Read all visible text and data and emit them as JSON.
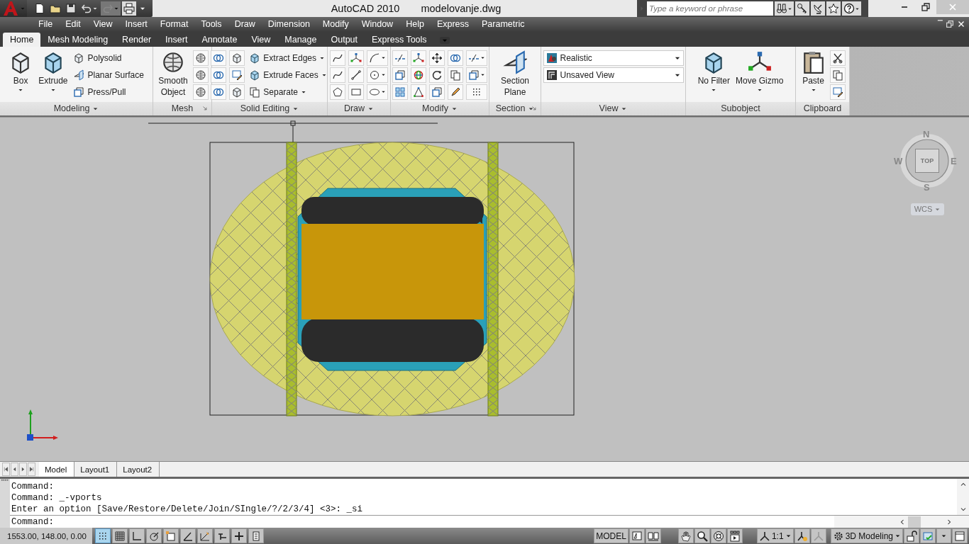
{
  "title": {
    "app": "AutoCAD 2010",
    "file": "modelovanje.dwg"
  },
  "search": {
    "placeholder": "Type a keyword or phrase"
  },
  "menu": [
    "File",
    "Edit",
    "View",
    "Insert",
    "Format",
    "Tools",
    "Draw",
    "Dimension",
    "Modify",
    "Window",
    "Help",
    "Express",
    "Parametric"
  ],
  "ribbon_tabs": [
    {
      "label": "Home",
      "selected": true
    },
    {
      "label": "Mesh Modeling",
      "selected": false
    },
    {
      "label": "Render",
      "selected": false
    },
    {
      "label": "Insert",
      "selected": false
    },
    {
      "label": "Annotate",
      "selected": false
    },
    {
      "label": "View",
      "selected": false
    },
    {
      "label": "Manage",
      "selected": false
    },
    {
      "label": "Output",
      "selected": false
    },
    {
      "label": "Express Tools",
      "selected": false
    }
  ],
  "ribbon_panels": [
    {
      "title": "Modeling",
      "menu": true,
      "launcher": false,
      "columns": [
        [
          {
            "kind": "large",
            "label": "Box",
            "menu": true
          }
        ],
        [
          {
            "kind": "large",
            "label": "Extrude",
            "menu": true
          }
        ],
        [
          {
            "kind": "small",
            "label": "Polysolid",
            "menu": false
          },
          {
            "kind": "small",
            "label": "Planar Surface",
            "menu": false
          },
          {
            "kind": "small",
            "label": "Press/Pull",
            "menu": false
          }
        ]
      ]
    },
    {
      "title": "Mesh",
      "menu": false,
      "launcher": true,
      "columns": [
        [
          {
            "kind": "large",
            "label": "Smooth Object",
            "menu": false
          }
        ],
        [
          {
            "kind": "icon",
            "menu": false
          },
          {
            "kind": "icon",
            "menu": false
          },
          {
            "kind": "icon",
            "menu": false
          }
        ]
      ]
    },
    {
      "title": "Solid Editing",
      "menu": true,
      "launcher": false,
      "columns": [
        [
          {
            "kind": "icon",
            "menu": false
          },
          {
            "kind": "icon",
            "menu": false
          },
          {
            "kind": "icon",
            "menu": false
          }
        ],
        [
          {
            "kind": "icon",
            "menu": false
          },
          {
            "kind": "icon",
            "menu": false
          },
          {
            "kind": "icon",
            "menu": false
          }
        ],
        [
          {
            "kind": "small",
            "label": "Extract Edges",
            "menu": true
          },
          {
            "kind": "small",
            "label": "Extrude Faces",
            "menu": true
          },
          {
            "kind": "small",
            "label": "Separate",
            "menu": true
          }
        ]
      ]
    },
    {
      "title": "Draw",
      "menu": true,
      "launcher": false,
      "columns": [
        [
          {
            "kind": "icon",
            "menu": false
          },
          {
            "kind": "icon",
            "menu": false
          },
          {
            "kind": "icon",
            "menu": false
          }
        ],
        [
          {
            "kind": "icon",
            "menu": false
          },
          {
            "kind": "icon",
            "menu": false
          },
          {
            "kind": "icon",
            "menu": false
          }
        ],
        [
          {
            "kind": "icon",
            "menu": true
          },
          {
            "kind": "icon",
            "menu": true
          },
          {
            "kind": "icon",
            "menu": true
          }
        ]
      ]
    },
    {
      "title": "Modify",
      "menu": true,
      "launcher": false,
      "columns": [
        [
          {
            "kind": "icon",
            "menu": false
          },
          {
            "kind": "icon",
            "menu": false
          },
          {
            "kind": "icon",
            "menu": false
          }
        ],
        [
          {
            "kind": "icon",
            "menu": false
          },
          {
            "kind": "icon",
            "menu": false
          },
          {
            "kind": "icon",
            "menu": false
          }
        ],
        [
          {
            "kind": "icon",
            "menu": false
          },
          {
            "kind": "icon",
            "menu": false
          },
          {
            "kind": "icon",
            "menu": false
          }
        ],
        [
          {
            "kind": "icon",
            "menu": false
          },
          {
            "kind": "icon",
            "menu": false
          },
          {
            "kind": "icon",
            "menu": false
          }
        ],
        [
          {
            "kind": "icon",
            "menu": true
          },
          {
            "kind": "icon",
            "menu": true
          },
          {
            "kind": "icon",
            "menu": false
          }
        ]
      ]
    },
    {
      "title": "Section",
      "menu": true,
      "launcher": true,
      "columns": [
        [
          {
            "kind": "large",
            "label": "Section Plane",
            "menu": false
          }
        ]
      ]
    },
    {
      "title": "View",
      "menu": true,
      "launcher": false,
      "columns": [
        [
          {
            "kind": "dropdown",
            "label": "Realistic"
          },
          {
            "kind": "dropdown",
            "label": "Unsaved View"
          }
        ]
      ]
    },
    {
      "title": "Subobject",
      "menu": false,
      "launcher": false,
      "columns": [
        [
          {
            "kind": "large",
            "label": "No Filter",
            "menu": true
          }
        ],
        [
          {
            "kind": "large",
            "label": "Move Gizmo",
            "menu": true
          }
        ]
      ]
    },
    {
      "title": "Clipboard",
      "menu": false,
      "launcher": false,
      "columns": [
        [
          {
            "kind": "large",
            "label": "Paste",
            "menu": true
          }
        ],
        [
          {
            "kind": "icon",
            "menu": false
          },
          {
            "kind": "icon",
            "menu": false
          },
          {
            "kind": "icon",
            "menu": false
          }
        ]
      ]
    }
  ],
  "viewcube": {
    "face": "TOP",
    "north": "N",
    "south": "S",
    "east": "E",
    "west": "W",
    "coordinate_system": "WCS"
  },
  "layout_tabs": [
    {
      "label": "Model",
      "selected": true
    },
    {
      "label": "Layout1",
      "selected": false
    },
    {
      "label": "Layout2",
      "selected": false
    }
  ],
  "command_history": [
    "Command:",
    "Command: _-vports",
    "Enter an option [Save/Restore/Delete/Join/SIngle/?/2/3/4] <3>: _si"
  ],
  "command_prompt": "Command:",
  "status_bar": {
    "coordinates": "1553.00, 148.00, 0.00",
    "toggles": [
      {
        "on": true
      },
      {
        "on": false
      },
      {
        "on": false
      },
      {
        "on": false
      },
      {
        "on": false
      },
      {
        "on": false
      },
      {
        "on": false
      },
      {
        "on": false
      },
      {
        "on": false
      },
      {
        "on": false
      }
    ],
    "space": "MODEL",
    "annotation_scale": "1:1",
    "workspace": "3D Modeling"
  }
}
